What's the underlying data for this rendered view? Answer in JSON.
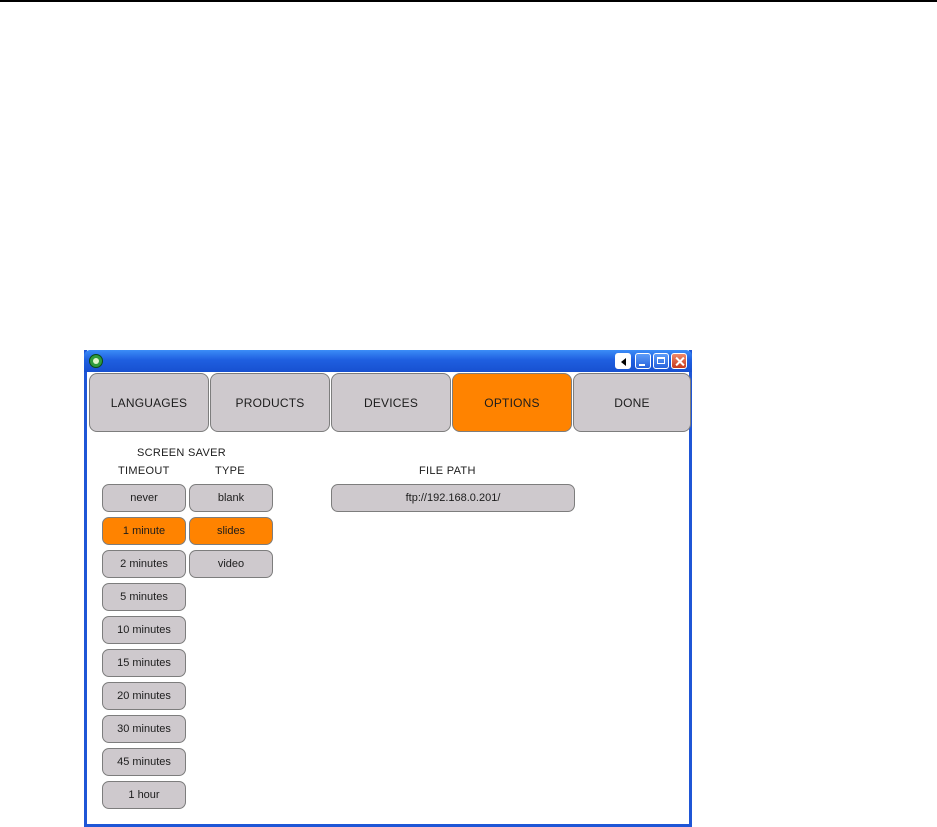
{
  "window": {
    "tabs": [
      {
        "label": "LANGUAGES",
        "active": false
      },
      {
        "label": "PRODUCTS",
        "active": false
      },
      {
        "label": "DEVICES",
        "active": false
      },
      {
        "label": "OPTIONS",
        "active": true
      },
      {
        "label": "DONE",
        "active": false
      }
    ]
  },
  "screen_saver": {
    "heading": "SCREEN SAVER",
    "timeout_label": "TIMEOUT",
    "type_label": "TYPE",
    "timeouts": [
      "never",
      "1 minute",
      "2 minutes",
      "5 minutes",
      "10 minutes",
      "15 minutes",
      "20 minutes",
      "30 minutes",
      "45 minutes",
      "1 hour"
    ],
    "selected_timeout": "1 minute",
    "types": [
      "blank",
      "slides",
      "video"
    ],
    "selected_type": "slides"
  },
  "file_path": {
    "label": "FILE PATH",
    "value": "ftp://192.168.0.201/"
  },
  "colors": {
    "accent": "#ff8300",
    "button": "#cec9cd",
    "titlebar": "#1f5fe0"
  }
}
